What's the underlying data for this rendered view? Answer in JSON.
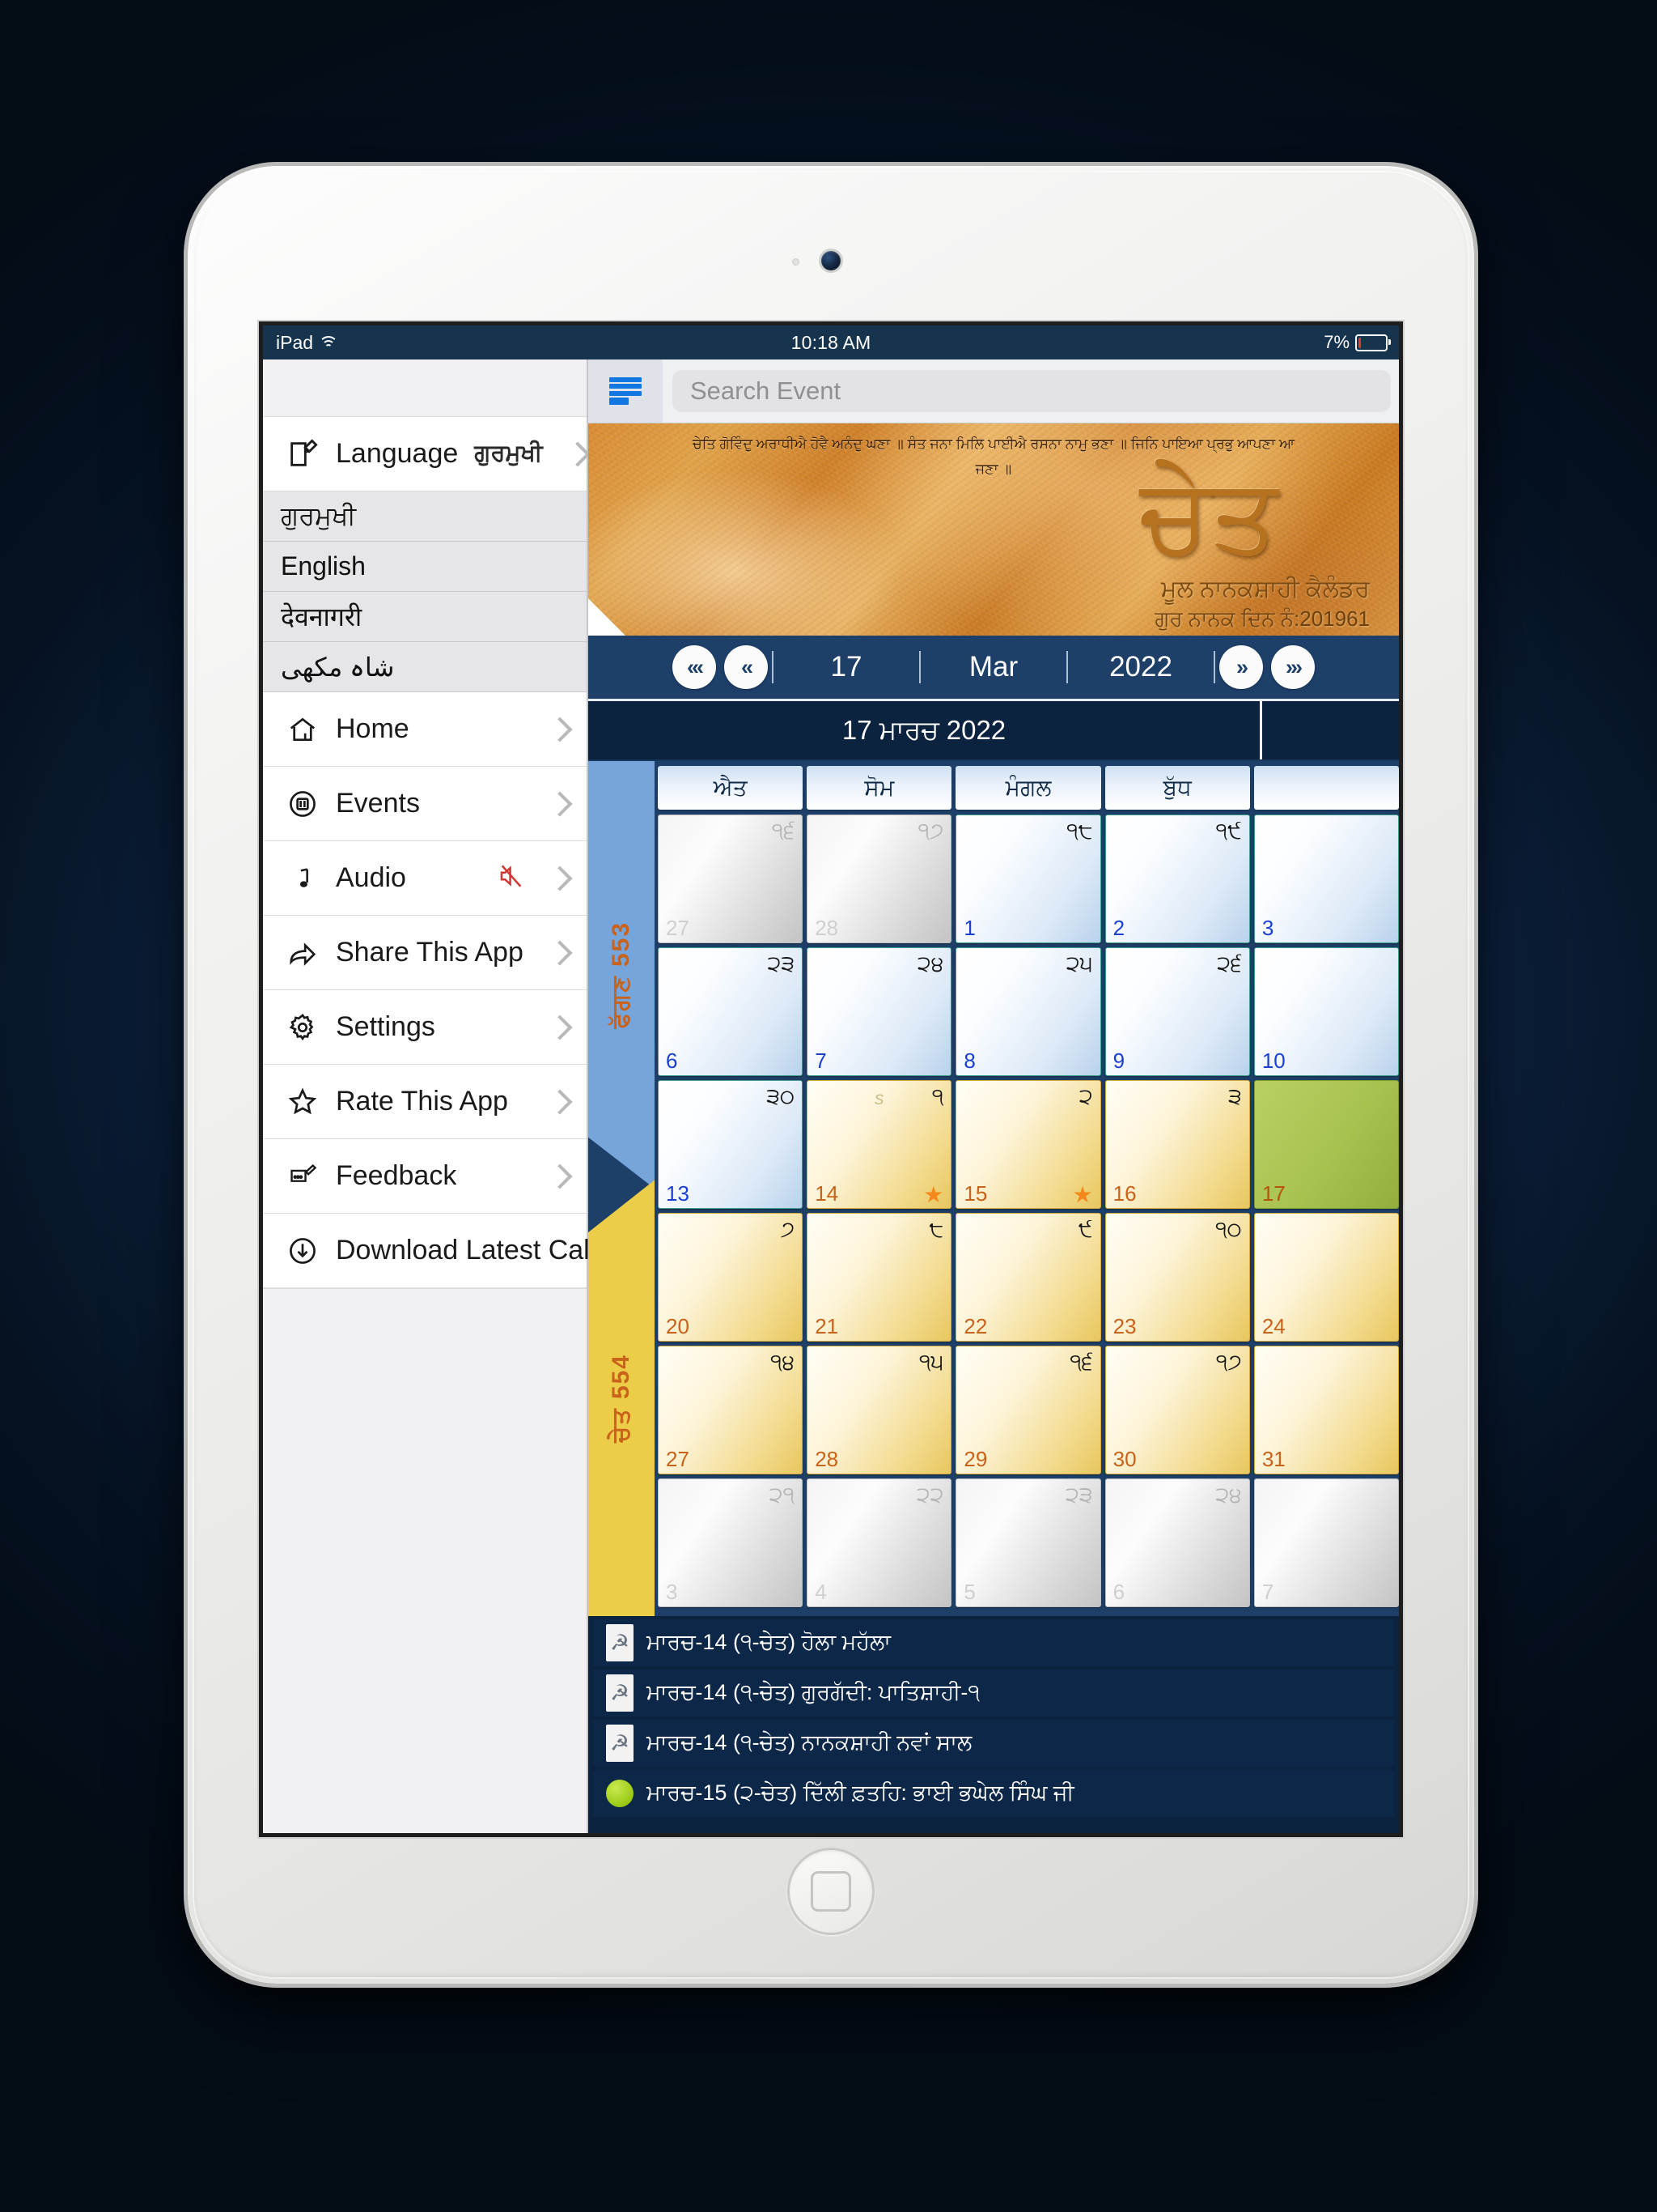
{
  "status_bar": {
    "device": "iPad",
    "wifi_icon": "wifi-icon",
    "time": "10:18 AM",
    "battery_percent": "7%",
    "battery_icon": "battery-icon"
  },
  "sidebar": {
    "language_row": {
      "icon": "compose-icon",
      "label": "Language",
      "value": "ਗੁਰਮੁਖੀ",
      "chevron": "chevron-right-icon"
    },
    "language_options": [
      {
        "label": "ਗੁਰਮੁਖੀ"
      },
      {
        "label": "English"
      },
      {
        "label": "देवनागरी"
      },
      {
        "label": "شاہ مکھی"
      }
    ],
    "items": [
      {
        "icon": "home-icon",
        "label": "Home",
        "badge": ""
      },
      {
        "icon": "events-icon",
        "label": "Events",
        "badge": ""
      },
      {
        "icon": "music-note-icon",
        "label": "Audio",
        "badge": "mute-icon"
      },
      {
        "icon": "share-icon",
        "label": "Share This App",
        "badge": ""
      },
      {
        "icon": "gear-icon",
        "label": "Settings",
        "badge": ""
      },
      {
        "icon": "star-icon",
        "label": "Rate This App",
        "badge": ""
      },
      {
        "icon": "feedback-icon",
        "label": "Feedback",
        "badge": ""
      },
      {
        "icon": "download-icon",
        "label": "Download Latest Calendar",
        "badge": ""
      }
    ]
  },
  "search": {
    "list_icon": "list-view-icon",
    "placeholder": "Search Event",
    "value": ""
  },
  "banner": {
    "quote_line1": "ਚੇਤਿ ਗੋਵਿੰਦੁ ਅਰਾਧੀਐ ਹੋਵੈ ਅਨੰਦੁ ਘਣਾ ॥ ਸੰਤ ਜਨਾ ਮਿਲਿ ਪਾਈਐ ਰਸਨਾ ਨਾਮੁ ਭਣਾ ॥ ਜਿਨਿ ਪਾਇਆ ਪ੍ਰਭੁ ਆਪਣਾ ਆ",
    "quote_line2": "ਜਣਾ ॥",
    "month_glyph": "ਚੇਤ",
    "subtitle": "ਮੂਲ ਨਾਨਕਸ਼ਾਹੀ ਕੈਲੰਡਰ",
    "nanak_day": "ਗੁਰ ਨਾਨਕ ਦਿਨ ਨੰ:201961"
  },
  "date_nav": {
    "first_button": "«‹",
    "prev_button": "«",
    "day": "17",
    "month": "Mar",
    "year": "2022",
    "next_button": "»",
    "last_button": "›»",
    "punjabi_date": "17 ਮਾਰਚ  2022"
  },
  "calendar": {
    "month_bands": [
      {
        "label": "ਫੱਗਣ 553",
        "color": "#76a5dc"
      },
      {
        "label": "ਚੇਤ 554",
        "color": "#eccd47"
      }
    ],
    "weekday_headers": [
      "ਐਤ",
      "ਸੋਮ",
      "ਮੰਗਲ",
      "ਬੁੱਧ",
      ""
    ],
    "weeks": [
      [
        {
          "nanakshahi": "੧੬",
          "gregorian": "27",
          "style": "grey",
          "star": false,
          "s": false
        },
        {
          "nanakshahi": "੧੭",
          "gregorian": "28",
          "style": "grey",
          "star": false,
          "s": false
        },
        {
          "nanakshahi": "੧੮",
          "gregorian": "1",
          "style": "blue",
          "star": false,
          "s": false
        },
        {
          "nanakshahi": "੧੯",
          "gregorian": "2",
          "style": "blue",
          "star": false,
          "s": false
        },
        {
          "nanakshahi": "",
          "gregorian": "3",
          "style": "blue",
          "star": false,
          "s": false
        }
      ],
      [
        {
          "nanakshahi": "੨੩",
          "gregorian": "6",
          "style": "blue",
          "star": false,
          "s": false
        },
        {
          "nanakshahi": "੨੪",
          "gregorian": "7",
          "style": "blue",
          "star": false,
          "s": false
        },
        {
          "nanakshahi": "੨੫",
          "gregorian": "8",
          "style": "blue",
          "star": false,
          "s": false
        },
        {
          "nanakshahi": "੨੬",
          "gregorian": "9",
          "style": "blue",
          "star": false,
          "s": false
        },
        {
          "nanakshahi": "",
          "gregorian": "10",
          "style": "blue",
          "star": false,
          "s": false
        }
      ],
      [
        {
          "nanakshahi": "੩੦",
          "gregorian": "13",
          "style": "blue",
          "star": false,
          "s": false
        },
        {
          "nanakshahi": "੧",
          "gregorian": "14",
          "style": "gold",
          "star": true,
          "s": true
        },
        {
          "nanakshahi": "੨",
          "gregorian": "15",
          "style": "gold",
          "star": true,
          "s": false
        },
        {
          "nanakshahi": "੩",
          "gregorian": "16",
          "style": "gold",
          "star": false,
          "s": false
        },
        {
          "nanakshahi": "",
          "gregorian": "17",
          "style": "today",
          "star": false,
          "s": false
        }
      ],
      [
        {
          "nanakshahi": "੭",
          "gregorian": "20",
          "style": "gold",
          "star": false,
          "s": false
        },
        {
          "nanakshahi": "੮",
          "gregorian": "21",
          "style": "gold",
          "star": false,
          "s": false
        },
        {
          "nanakshahi": "੯",
          "gregorian": "22",
          "style": "gold",
          "star": false,
          "s": false
        },
        {
          "nanakshahi": "੧੦",
          "gregorian": "23",
          "style": "gold",
          "star": false,
          "s": false
        },
        {
          "nanakshahi": "",
          "gregorian": "24",
          "style": "gold",
          "star": false,
          "s": false
        }
      ],
      [
        {
          "nanakshahi": "੧੪",
          "gregorian": "27",
          "style": "gold",
          "star": false,
          "s": false
        },
        {
          "nanakshahi": "੧੫",
          "gregorian": "28",
          "style": "gold",
          "star": false,
          "s": false
        },
        {
          "nanakshahi": "੧੬",
          "gregorian": "29",
          "style": "gold",
          "star": false,
          "s": false
        },
        {
          "nanakshahi": "੧੭",
          "gregorian": "30",
          "style": "gold",
          "star": false,
          "s": false
        },
        {
          "nanakshahi": "",
          "gregorian": "31",
          "style": "gold",
          "star": false,
          "s": false
        }
      ],
      [
        {
          "nanakshahi": "੨੧",
          "gregorian": "3",
          "style": "grey",
          "star": false,
          "s": false
        },
        {
          "nanakshahi": "੨੨",
          "gregorian": "4",
          "style": "grey",
          "star": false,
          "s": false
        },
        {
          "nanakshahi": "੨੩",
          "gregorian": "5",
          "style": "grey",
          "star": false,
          "s": false
        },
        {
          "nanakshahi": "੨੪",
          "gregorian": "6",
          "style": "grey",
          "star": false,
          "s": false
        },
        {
          "nanakshahi": "",
          "gregorian": "7",
          "style": "grey",
          "star": false,
          "s": false
        }
      ]
    ]
  },
  "events": [
    {
      "icon": "khanda-icon",
      "text": "ਮਾਰਚ-14 (੧-ਚੇਤ) ਹੋਲਾ ਮਹੱਲਾ"
    },
    {
      "icon": "khanda-icon",
      "text": "ਮਾਰਚ-14 (੧-ਚੇਤ) ਗੁਰਗੱਦੀ: ਪਾਤਿਸ਼ਾਹੀ-੧"
    },
    {
      "icon": "khanda-icon",
      "text": "ਮਾਰਚ-14 (੧-ਚੇਤ) ਨਾਨਕਸ਼ਾਹੀ ਨਵਾਂ ਸਾਲ"
    },
    {
      "icon": "green-dot-icon",
      "text": "ਮਾਰਚ-15 (੨-ਚੇਤ) ਦਿੱਲੀ ਫ਼ਤਹਿ: ਭਾਈ ਭਘੇਲ ਸਿੰਘ ਜੀ"
    }
  ],
  "colors": {
    "accent_blue": "#1d3f68",
    "dark_navy": "#0c2340",
    "gold": "#eccd47",
    "today_green": "#a8c250",
    "star_orange": "#f3891a"
  }
}
